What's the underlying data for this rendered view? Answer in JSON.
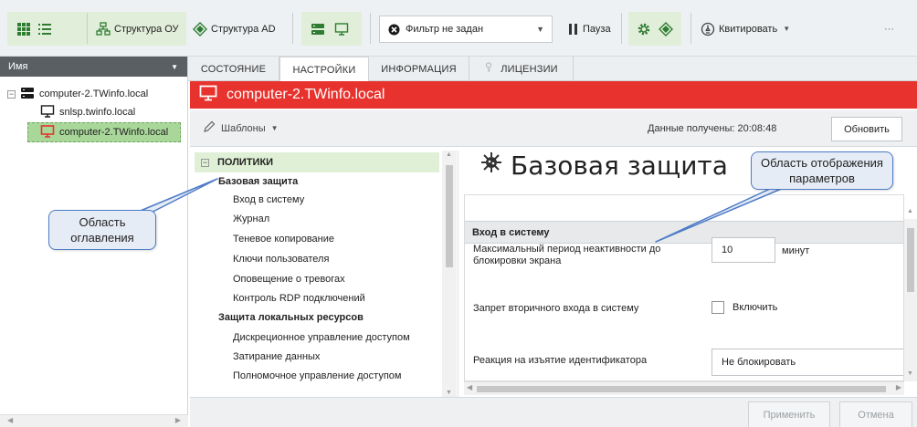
{
  "toolbar": {
    "structure_ou": "Структура ОУ",
    "structure_ad": "Структура AD",
    "filter_label": "Фильтр не задан",
    "pause_label": "Пауза",
    "acknowledge_label": "Квитировать",
    "more_label": "···"
  },
  "tree": {
    "header": "Имя",
    "root": "computer-2.TWinfo.local",
    "child1": "snlsp.twinfo.local",
    "child2": "computer-2.TWinfo.local"
  },
  "tabs": {
    "state": "СОСТОЯНИЕ",
    "settings": "НАСТРОЙКИ",
    "info": "ИНФОРМАЦИЯ",
    "licenses": "ЛИЦЕНЗИИ"
  },
  "header": {
    "computer_name": "computer-2.TWinfo.local",
    "templates": "Шаблоны",
    "received": "Данные получены: 20:08:48",
    "refresh": "Обновить"
  },
  "toc": {
    "policies": "ПОЛИТИКИ",
    "basic_protection": "Базовая защита",
    "items_basic": [
      "Вход в систему",
      "Журнал",
      "Теневое копирование",
      "Ключи пользователя",
      "Оповещение о тревогах",
      "Контроль RDP подключений"
    ],
    "local_resources": "Защита локальных ресурсов",
    "items_local": [
      "Дискреционное управление доступом",
      "Затирание данных",
      "Полномочное управление доступом"
    ]
  },
  "content": {
    "title": "Базовая защита",
    "section": "Вход в систему",
    "param1_label": "Максимальный период неактивности до блокировки экрана",
    "param1_value": "10",
    "param1_unit": "минут",
    "param2_label": "Запрет вторичного входа в систему",
    "param2_check": "Включить",
    "param3_label": "Реакция на изъятие идентификатора",
    "param3_value": "Не блокировать"
  },
  "footer": {
    "apply": "Применить",
    "cancel": "Отмена"
  },
  "callouts": {
    "toc_line1": "Область",
    "toc_line2": "оглавления",
    "params_line1": "Область отображения",
    "params_line2": "параметров"
  },
  "colors": {
    "accent_red": "#e8322d",
    "accent_green": "#2e7d32",
    "selected_green": "#a9d79a",
    "callout_border": "#4d7bc6"
  }
}
